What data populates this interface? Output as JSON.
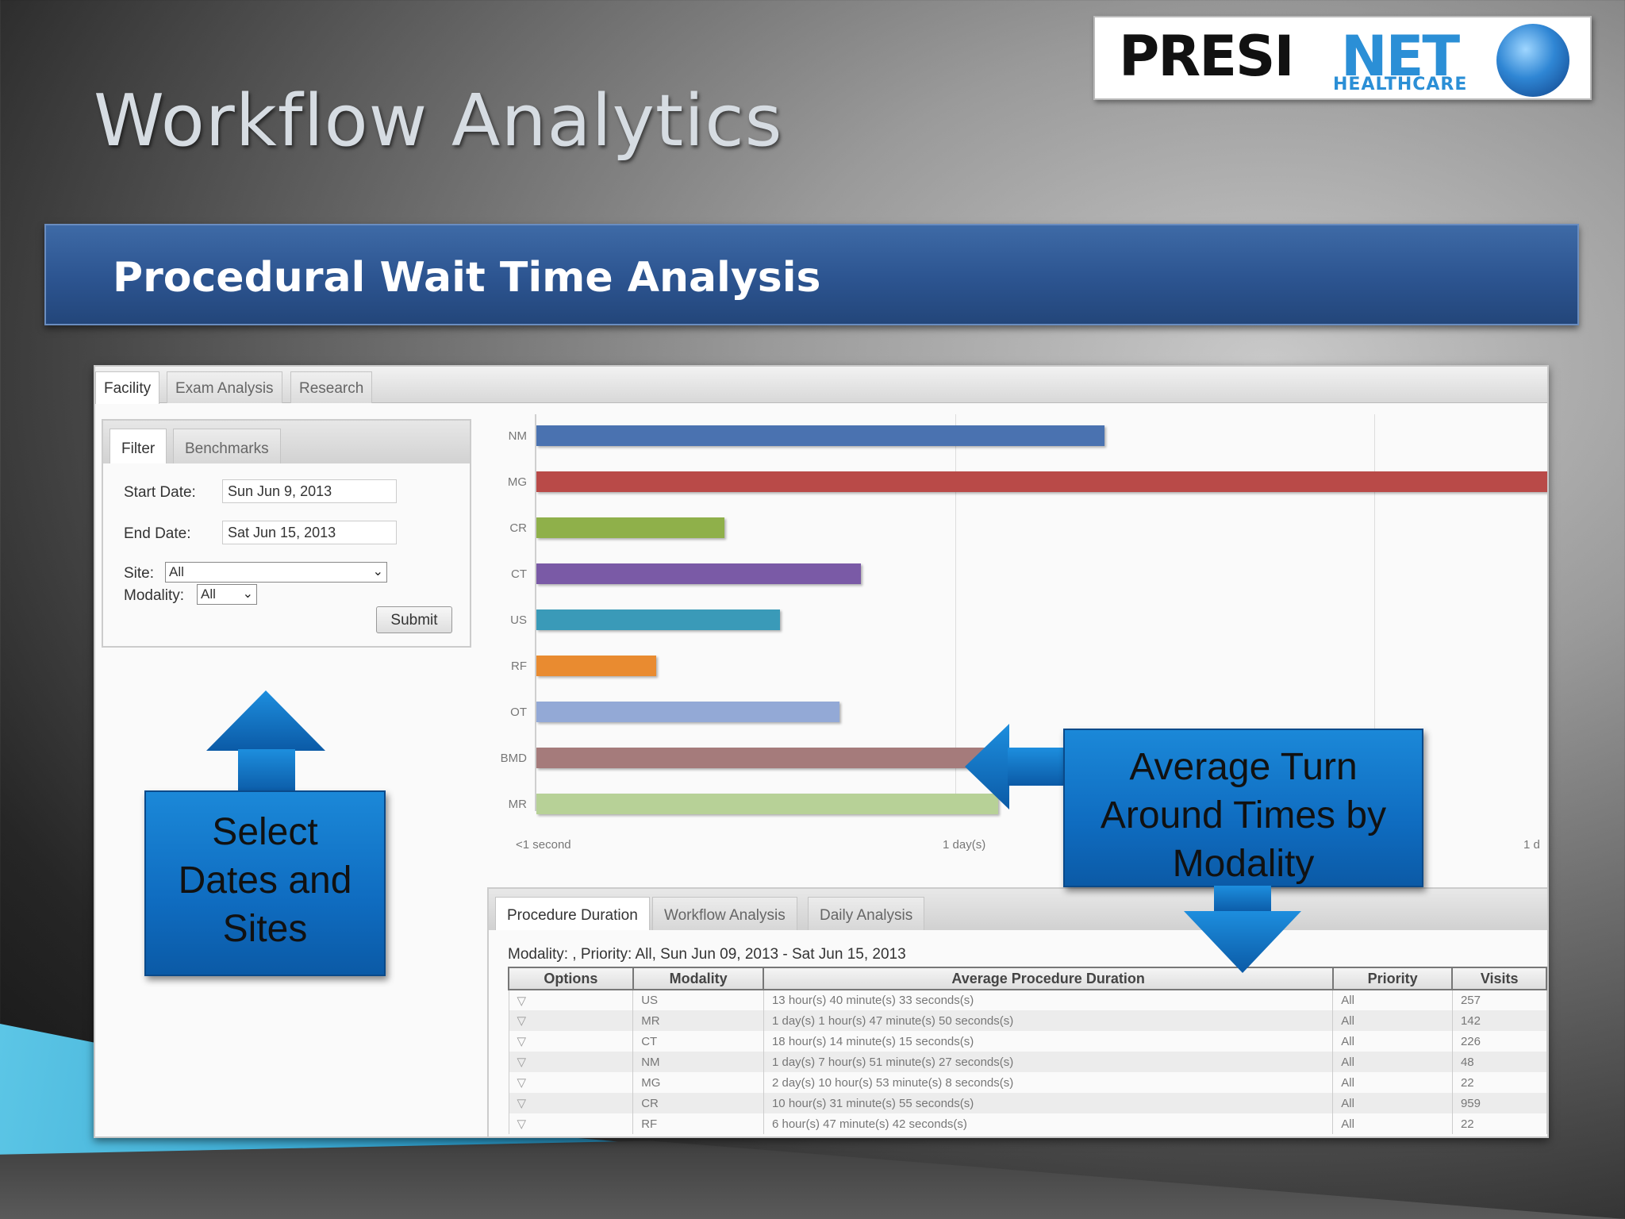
{
  "slide": {
    "title": "Workflow Analytics",
    "banner": "Procedural Wait Time Analysis"
  },
  "logo": {
    "presi": "PRESI",
    "net": "NET",
    "healthcare": "HEALTHCARE",
    "globe_icon": "globe-icon"
  },
  "app": {
    "tabs": [
      "Facility",
      "Exam Analysis",
      "Research"
    ],
    "active_tab": "Facility",
    "filter": {
      "tabs": [
        "Filter",
        "Benchmarks"
      ],
      "start_label": "Start Date:",
      "start_value": "Sun Jun 9, 2013",
      "end_label": "End Date:",
      "end_value": "Sat Jun 15, 2013",
      "site_label": "Site:",
      "site_value": "All",
      "modality_label": "Modality:",
      "modality_value": "All",
      "submit": "Submit"
    },
    "bottom_tabs": [
      "Procedure Duration",
      "Workflow Analysis",
      "Daily Analysis"
    ],
    "summary": "Modality: , Priority: All, Sun Jun 09, 2013 - Sat Jun 15, 2013",
    "table": {
      "headers": [
        "Options",
        "Modality",
        "Average Procedure Duration",
        "Priority",
        "Visits"
      ],
      "rows": [
        [
          "US",
          "13 hour(s) 40 minute(s) 33 seconds(s)",
          "All",
          "257"
        ],
        [
          "MR",
          "1 day(s) 1 hour(s) 47 minute(s) 50 seconds(s)",
          "All",
          "142"
        ],
        [
          "CT",
          "18 hour(s) 14 minute(s) 15 seconds(s)",
          "All",
          "226"
        ],
        [
          "NM",
          "1 day(s) 7 hour(s) 51 minute(s) 27 seconds(s)",
          "All",
          "48"
        ],
        [
          "MG",
          "2 day(s) 10 hour(s) 53 minute(s) 8 seconds(s)",
          "All",
          "22"
        ],
        [
          "CR",
          "10 hour(s) 31 minute(s) 55 seconds(s)",
          "All",
          "959"
        ],
        [
          "RF",
          "6 hour(s) 47 minute(s) 42 seconds(s)",
          "All",
          "22"
        ]
      ],
      "option_icon": "filter-icon"
    }
  },
  "callouts": {
    "left": [
      "Select",
      "Dates and",
      "Sites"
    ],
    "right": [
      "Average Turn",
      "Around Times by",
      "Modality"
    ]
  },
  "chart_data": {
    "type": "bar",
    "orientation": "horizontal",
    "categories": [
      "NM",
      "MG",
      "CR",
      "CT",
      "US",
      "RF",
      "OT",
      "BMD",
      "MR"
    ],
    "values_days": [
      1.33,
      2.45,
      0.44,
      0.76,
      0.57,
      0.28,
      0.71,
      1.09,
      1.08
    ],
    "colors": [
      "#4a72b0",
      "#b94a48",
      "#8fb04a",
      "#7a5aa6",
      "#3a9ab8",
      "#e98b30",
      "#93a9d6",
      "#a57b7b",
      "#b7d197"
    ],
    "x_ticks": [
      "<1 second",
      "1 day(s)",
      "1 d"
    ],
    "xlim_days": [
      0,
      2
    ]
  }
}
